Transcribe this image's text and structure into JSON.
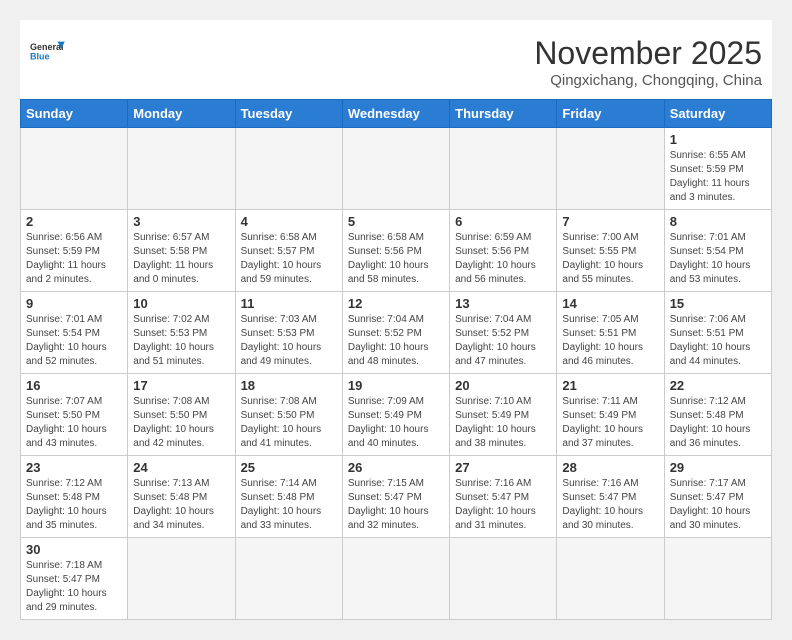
{
  "logo": {
    "line1": "General",
    "line2": "Blue"
  },
  "title": "November 2025",
  "location": "Qingxichang, Chongqing, China",
  "days_header": [
    "Sunday",
    "Monday",
    "Tuesday",
    "Wednesday",
    "Thursday",
    "Friday",
    "Saturday"
  ],
  "weeks": [
    [
      {
        "num": "",
        "info": ""
      },
      {
        "num": "",
        "info": ""
      },
      {
        "num": "",
        "info": ""
      },
      {
        "num": "",
        "info": ""
      },
      {
        "num": "",
        "info": ""
      },
      {
        "num": "",
        "info": ""
      },
      {
        "num": "1",
        "info": "Sunrise: 6:55 AM\nSunset: 5:59 PM\nDaylight: 11 hours\nand 3 minutes."
      }
    ],
    [
      {
        "num": "2",
        "info": "Sunrise: 6:56 AM\nSunset: 5:59 PM\nDaylight: 11 hours\nand 2 minutes."
      },
      {
        "num": "3",
        "info": "Sunrise: 6:57 AM\nSunset: 5:58 PM\nDaylight: 11 hours\nand 0 minutes."
      },
      {
        "num": "4",
        "info": "Sunrise: 6:58 AM\nSunset: 5:57 PM\nDaylight: 10 hours\nand 59 minutes."
      },
      {
        "num": "5",
        "info": "Sunrise: 6:58 AM\nSunset: 5:56 PM\nDaylight: 10 hours\nand 58 minutes."
      },
      {
        "num": "6",
        "info": "Sunrise: 6:59 AM\nSunset: 5:56 PM\nDaylight: 10 hours\nand 56 minutes."
      },
      {
        "num": "7",
        "info": "Sunrise: 7:00 AM\nSunset: 5:55 PM\nDaylight: 10 hours\nand 55 minutes."
      },
      {
        "num": "8",
        "info": "Sunrise: 7:01 AM\nSunset: 5:54 PM\nDaylight: 10 hours\nand 53 minutes."
      }
    ],
    [
      {
        "num": "9",
        "info": "Sunrise: 7:01 AM\nSunset: 5:54 PM\nDaylight: 10 hours\nand 52 minutes."
      },
      {
        "num": "10",
        "info": "Sunrise: 7:02 AM\nSunset: 5:53 PM\nDaylight: 10 hours\nand 51 minutes."
      },
      {
        "num": "11",
        "info": "Sunrise: 7:03 AM\nSunset: 5:53 PM\nDaylight: 10 hours\nand 49 minutes."
      },
      {
        "num": "12",
        "info": "Sunrise: 7:04 AM\nSunset: 5:52 PM\nDaylight: 10 hours\nand 48 minutes."
      },
      {
        "num": "13",
        "info": "Sunrise: 7:04 AM\nSunset: 5:52 PM\nDaylight: 10 hours\nand 47 minutes."
      },
      {
        "num": "14",
        "info": "Sunrise: 7:05 AM\nSunset: 5:51 PM\nDaylight: 10 hours\nand 46 minutes."
      },
      {
        "num": "15",
        "info": "Sunrise: 7:06 AM\nSunset: 5:51 PM\nDaylight: 10 hours\nand 44 minutes."
      }
    ],
    [
      {
        "num": "16",
        "info": "Sunrise: 7:07 AM\nSunset: 5:50 PM\nDaylight: 10 hours\nand 43 minutes."
      },
      {
        "num": "17",
        "info": "Sunrise: 7:08 AM\nSunset: 5:50 PM\nDaylight: 10 hours\nand 42 minutes."
      },
      {
        "num": "18",
        "info": "Sunrise: 7:08 AM\nSunset: 5:50 PM\nDaylight: 10 hours\nand 41 minutes."
      },
      {
        "num": "19",
        "info": "Sunrise: 7:09 AM\nSunset: 5:49 PM\nDaylight: 10 hours\nand 40 minutes."
      },
      {
        "num": "20",
        "info": "Sunrise: 7:10 AM\nSunset: 5:49 PM\nDaylight: 10 hours\nand 38 minutes."
      },
      {
        "num": "21",
        "info": "Sunrise: 7:11 AM\nSunset: 5:49 PM\nDaylight: 10 hours\nand 37 minutes."
      },
      {
        "num": "22",
        "info": "Sunrise: 7:12 AM\nSunset: 5:48 PM\nDaylight: 10 hours\nand 36 minutes."
      }
    ],
    [
      {
        "num": "23",
        "info": "Sunrise: 7:12 AM\nSunset: 5:48 PM\nDaylight: 10 hours\nand 35 minutes."
      },
      {
        "num": "24",
        "info": "Sunrise: 7:13 AM\nSunset: 5:48 PM\nDaylight: 10 hours\nand 34 minutes."
      },
      {
        "num": "25",
        "info": "Sunrise: 7:14 AM\nSunset: 5:48 PM\nDaylight: 10 hours\nand 33 minutes."
      },
      {
        "num": "26",
        "info": "Sunrise: 7:15 AM\nSunset: 5:47 PM\nDaylight: 10 hours\nand 32 minutes."
      },
      {
        "num": "27",
        "info": "Sunrise: 7:16 AM\nSunset: 5:47 PM\nDaylight: 10 hours\nand 31 minutes."
      },
      {
        "num": "28",
        "info": "Sunrise: 7:16 AM\nSunset: 5:47 PM\nDaylight: 10 hours\nand 30 minutes."
      },
      {
        "num": "29",
        "info": "Sunrise: 7:17 AM\nSunset: 5:47 PM\nDaylight: 10 hours\nand 30 minutes."
      }
    ],
    [
      {
        "num": "30",
        "info": "Sunrise: 7:18 AM\nSunset: 5:47 PM\nDaylight: 10 hours\nand 29 minutes."
      },
      {
        "num": "",
        "info": ""
      },
      {
        "num": "",
        "info": ""
      },
      {
        "num": "",
        "info": ""
      },
      {
        "num": "",
        "info": ""
      },
      {
        "num": "",
        "info": ""
      },
      {
        "num": "",
        "info": ""
      }
    ]
  ]
}
